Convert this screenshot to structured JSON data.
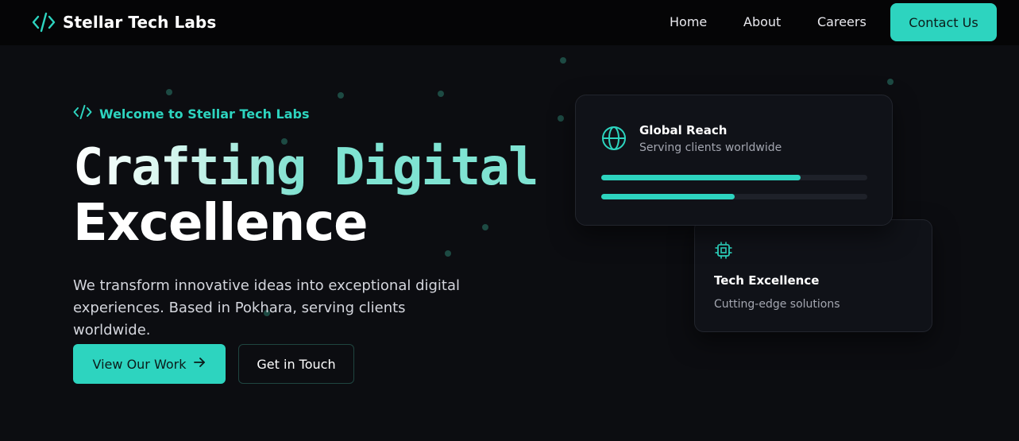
{
  "nav": {
    "brand": "Stellar Tech Labs",
    "brand_icon": "code-icon",
    "links": [
      "Home",
      "About",
      "Careers"
    ],
    "contact_label": "Contact Us"
  },
  "hero": {
    "eyebrow": "Welcome to Stellar Tech Labs",
    "eyebrow_icon": "code-icon",
    "headline_word1": "Crafting",
    "headline_word2": "Digital",
    "headline_line2": "Excellence",
    "description": "We transform innovative ideas into exceptional digital experiences. Based in Pokhara, serving clients worldwide.",
    "primary_button": "View Our Work",
    "primary_button_icon": "arrow-right-icon",
    "secondary_button": "Get in Touch"
  },
  "cards": {
    "global_reach": {
      "icon": "globe-icon",
      "title": "Global Reach",
      "subtitle": "Serving clients worldwide",
      "progress": [
        0.75,
        0.5
      ]
    },
    "tech_excellence": {
      "icon": "chip-icon",
      "title": "Tech Excellence",
      "subtitle": "Cutting-edge solutions"
    }
  },
  "colors": {
    "accent": "#2dd4bf",
    "background": "#0c0d11",
    "nav_background": "#050506"
  }
}
